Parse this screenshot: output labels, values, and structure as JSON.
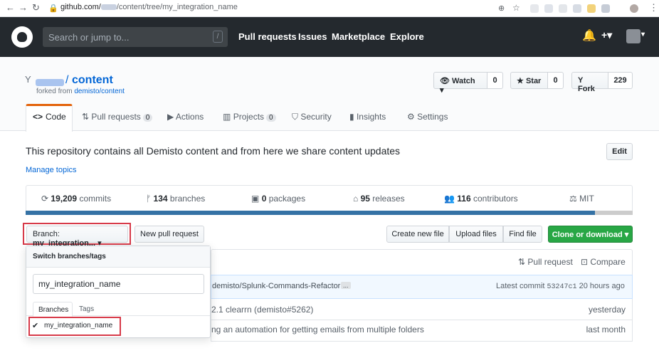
{
  "browser": {
    "url_host": "github.com/",
    "url_path": "/content/tree/my_integration_name"
  },
  "header": {
    "search_placeholder": "Search or jump to...",
    "slash_key": "/",
    "nav": [
      "Pull requests",
      "Issues",
      "Marketplace",
      "Explore"
    ],
    "plus": "+▾"
  },
  "repo": {
    "slash": "/",
    "name": "content",
    "forked_from_label": "forked from ",
    "forked_from": "demisto/content",
    "watch_label": "Watch ▾",
    "watch_count": "0",
    "star_label": "Star",
    "star_count": "0",
    "fork_label": "Fork",
    "fork_count": "229"
  },
  "tabs": [
    {
      "label": "Code",
      "icon": "code-icon"
    },
    {
      "label": "Pull requests",
      "badge": "0",
      "icon": "pr-icon"
    },
    {
      "label": "Actions",
      "icon": "play-icon"
    },
    {
      "label": "Projects",
      "badge": "0",
      "icon": "project-icon"
    },
    {
      "label": "Security",
      "icon": "shield-icon"
    },
    {
      "label": "Insights",
      "icon": "graph-icon"
    },
    {
      "label": "Settings",
      "icon": "gear-icon"
    }
  ],
  "description": "This repository contains all Demisto content and from here we share content updates",
  "edit_label": "Edit",
  "manage_topics": "Manage topics",
  "summary": [
    {
      "num": "19,209",
      "label": " commits"
    },
    {
      "num": "134",
      "label": " branches"
    },
    {
      "num": "0",
      "label": " packages"
    },
    {
      "num": "95",
      "label": " releases"
    },
    {
      "num": "116",
      "label": " contributors"
    },
    {
      "num": "",
      "label": "MIT"
    }
  ],
  "toolbar": {
    "branch_label": "Branch: ",
    "branch_name": "my_integration...",
    "caret": "▾",
    "new_pr": "New pull request",
    "create_file": "Create new file",
    "upload_files": "Upload files",
    "find_file": "Find file",
    "clone": "Clone or download ▾"
  },
  "dropdown": {
    "title": "Switch branches/tags",
    "filter_value": "my_integration_name",
    "tab_branches": "Branches",
    "tab_tags": "Tags",
    "item_check": "✔",
    "item": "my_integration_name"
  },
  "compare_bar": {
    "pull_request": "Pull request",
    "compare": "Compare"
  },
  "commit": {
    "message": "demisto/Splunk-Commands-Refactor",
    "ellipsis": "...",
    "latest_label": "Latest commit ",
    "sha": "53247c1",
    "time": " 20 hours ago"
  },
  "rows": [
    {
      "message": "2.1 clearrn (demisto#5262)",
      "time": "yesterday"
    },
    {
      "message": "ng an automation for getting emails from multiple folders",
      "time": "last month"
    }
  ],
  "colors": {
    "header_bg": "#24292e",
    "link": "#0366d6",
    "green": "#28a745",
    "red_highlight": "#d73a49",
    "lang_bar": "#3572A5"
  }
}
